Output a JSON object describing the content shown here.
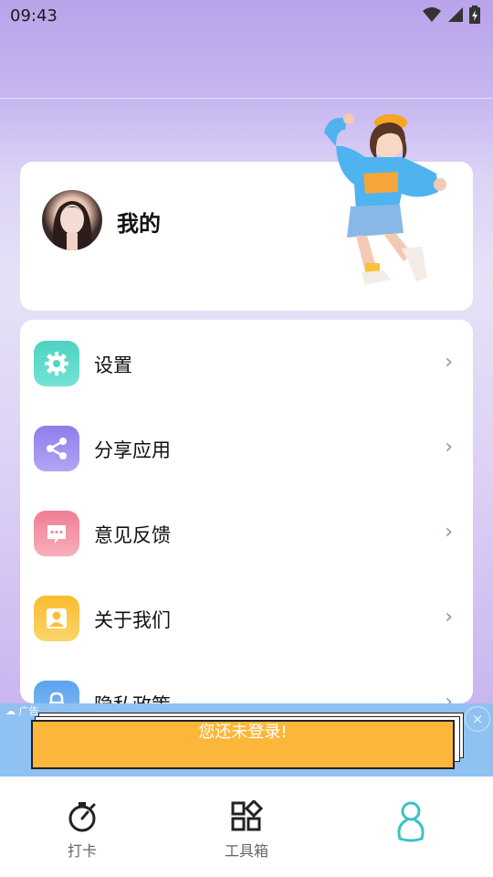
{
  "status_bar": {
    "time": "09:43"
  },
  "profile": {
    "name": "我的"
  },
  "menu": {
    "items": [
      {
        "label": "设置",
        "icon": "gear-icon",
        "color_from": "#4ed1c1",
        "color_to": "#73e4d4"
      },
      {
        "label": "分享应用",
        "icon": "share-icon",
        "color_from": "#8f7dea",
        "color_to": "#b2a6f3"
      },
      {
        "label": "意见反馈",
        "icon": "chat-bubble-icon",
        "color_from": "#f07e96",
        "color_to": "#f7aebb"
      },
      {
        "label": "关于我们",
        "icon": "user-icon",
        "color_from": "#f9bb2f",
        "color_to": "#fbd56a"
      },
      {
        "label": "隐私政策",
        "icon": "lock-icon",
        "color_from": "#5aa3ef",
        "color_to": "#8cc0f5"
      }
    ]
  },
  "ad": {
    "tag": "广告",
    "button_label": "您还未登录!"
  },
  "bottom_nav": {
    "items": [
      {
        "label": "打卡",
        "icon": "stopwatch-icon"
      },
      {
        "label": "工具箱",
        "icon": "toolbox-grid-icon"
      },
      {
        "label": "",
        "icon": "profile-person-icon",
        "active_color": "#3cc2c2"
      }
    ]
  }
}
